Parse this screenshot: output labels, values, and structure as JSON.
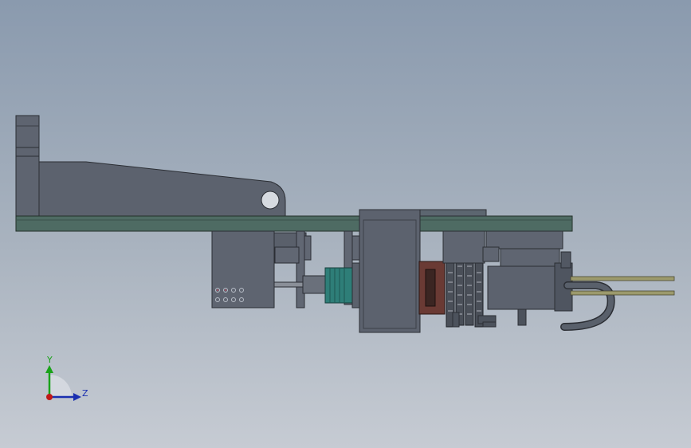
{
  "viewport": {
    "background_top": "#8a9aae",
    "background_bottom": "#c6cbd3"
  },
  "model": {
    "body_color": "#5d6370",
    "plate_color": "#4e6b63",
    "coupling_color": "#2e7e78",
    "brake_color": "#6a3a34",
    "cable_color": "#4f5560",
    "rod_color": "#9c9a6c"
  },
  "triad": {
    "y_label": "Y",
    "z_label": "Z",
    "y_color": "#1aa31a",
    "z_color": "#1a2fb0",
    "x_color": "#c01818"
  }
}
